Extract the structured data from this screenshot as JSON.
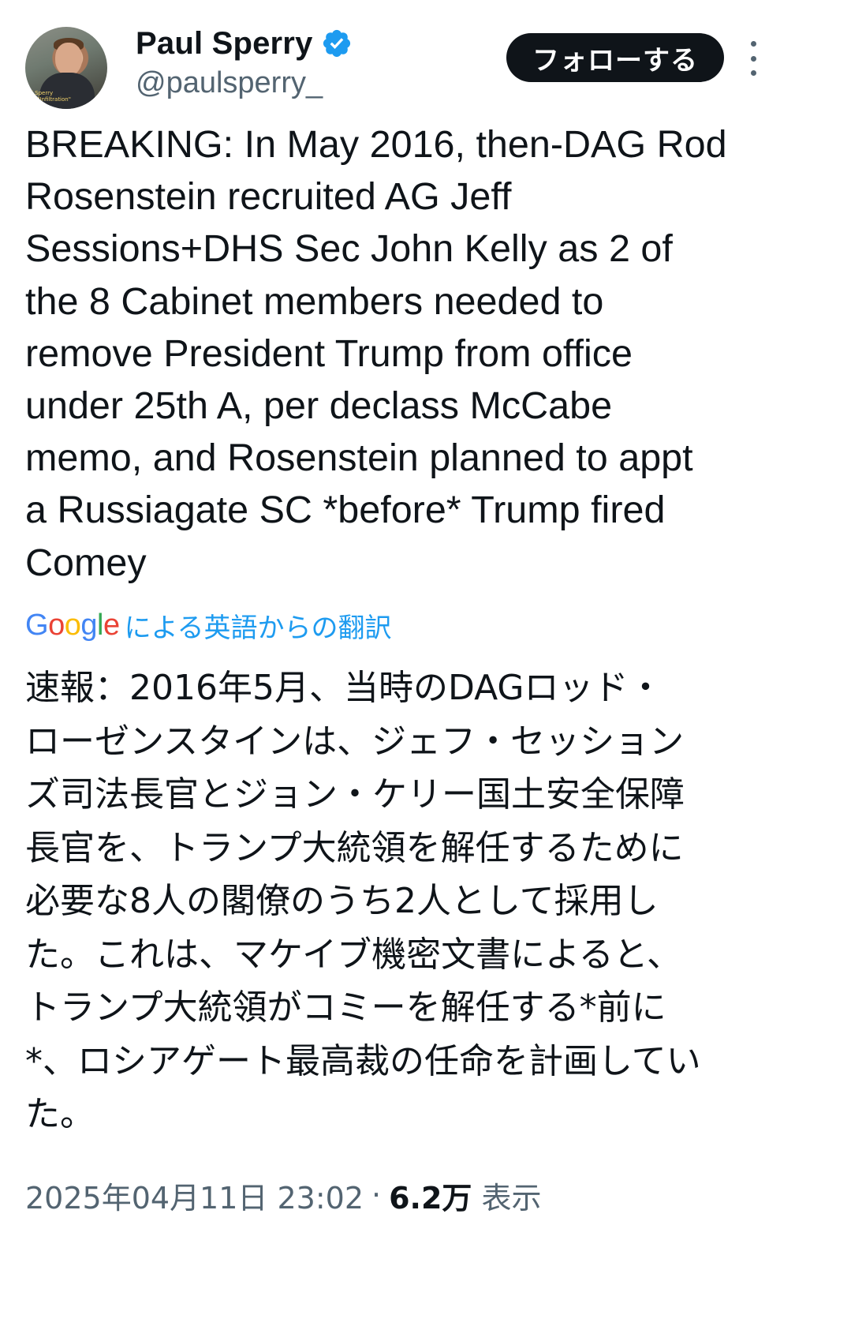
{
  "author": {
    "display_name": "Paul Sperry",
    "handle": "@paulsperry_",
    "verified": true,
    "avatar_icon": "profile-photo",
    "avatar_caption_line1": "l Sperry",
    "avatar_caption_line2": "r, \"Infiltration\""
  },
  "actions": {
    "follow_label": "フォローする",
    "more_icon": "more-vertical-icon"
  },
  "tweet": {
    "text": "BREAKING: In May 2016, then-DAG Rod\nRosenstein recruited AG Jeff\nSessions+DHS Sec John Kelly as 2 of\nthe 8 Cabinet members needed to\nremove President Trump from office\nunder 25th A, per declass McCabe\nmemo, and Rosenstein planned to appt\na Russiagate SC *before* Trump fired\nComey"
  },
  "translation": {
    "provider_logo": "Google",
    "label": "による英語からの翻訳",
    "text": "速報：2016年5月、当時のDAGロッド・\nローゼンスタインは、ジェフ・セッション\nズ司法長官とジョン・ケリー国土安全保障\n長官を、トランプ大統領を解任するために\n必要な8人の閣僚のうち2人として採用し\nた。これは、マケイブ機密文書によると、\nトランプ大統領がコミーを解任する*前に\n*、ロシアゲート最高裁の任命を計画してい\nた。"
  },
  "meta": {
    "timestamp": "2025年04月11日 23:02",
    "separator": "·",
    "views_count": "6.2万",
    "views_label": "表示"
  },
  "colors": {
    "text_primary": "#0f1419",
    "text_secondary": "#536471",
    "link_blue": "#1d9bf0",
    "verified_blue": "#1d9bf0",
    "button_bg": "#0f1419"
  }
}
